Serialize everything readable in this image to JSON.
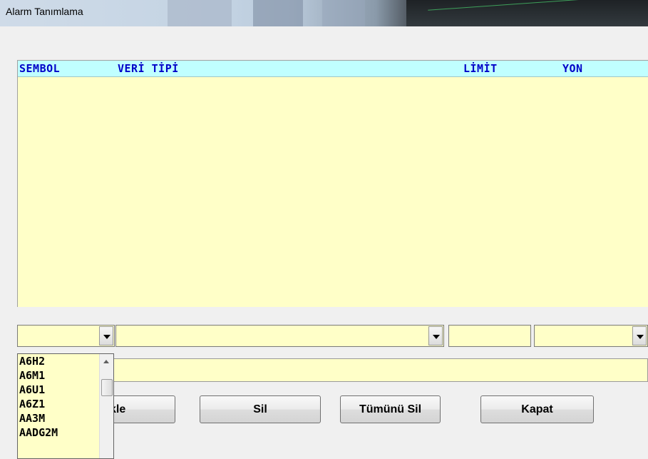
{
  "window": {
    "title": "Alarm Tanımlama"
  },
  "grid": {
    "columns": [
      "SEMBOL",
      "VERİ TİPİ",
      "LİMİT",
      "YON"
    ],
    "rows": []
  },
  "inputs": {
    "symbol_combo_value": "",
    "datatype_combo_value": "",
    "limit_value": "",
    "direction_combo_value": "",
    "message_value": ""
  },
  "buttons": {
    "add_label_visible": "kle",
    "delete_label": "Sil",
    "delete_all_label": "Tümünü Sil",
    "close_label": "Kapat"
  },
  "symbol_dropdown": {
    "items": [
      "A6H2",
      "A6M1",
      "A6U1",
      "A6Z1",
      "AA3M",
      "AADG2M"
    ]
  },
  "colors": {
    "field_bg": "#ffffc8",
    "header_bg": "#c0ffff",
    "header_text": "#0000c8"
  }
}
